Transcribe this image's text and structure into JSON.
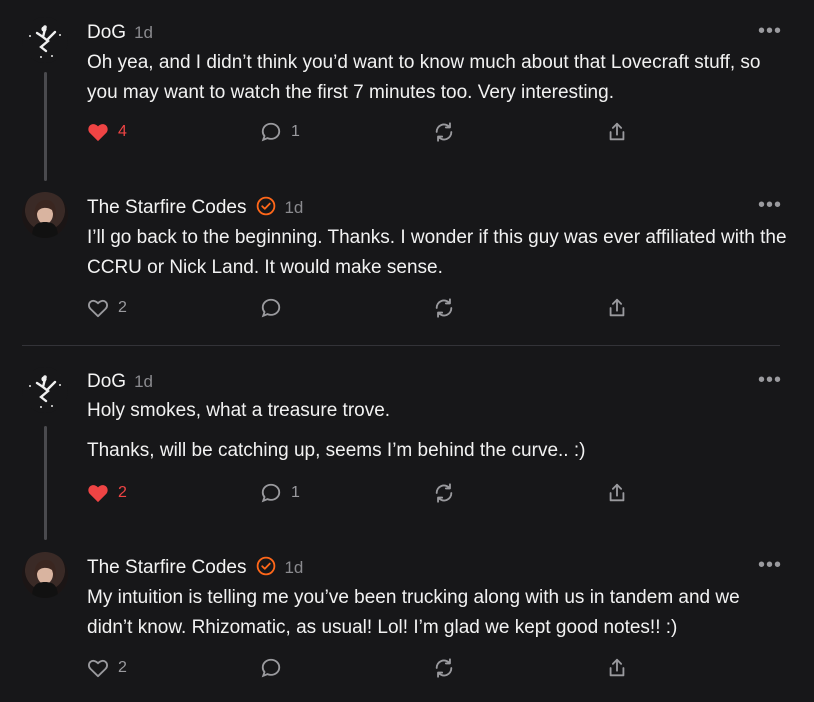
{
  "posts": [
    {
      "author": "DoG",
      "time": "1d",
      "verified": false,
      "paragraphs": [
        "Oh yea, and I didn’t think you’d want to know much about that Lovecraft stuff, so you may want to watch the first 7 minutes too. Very interesting."
      ],
      "likes": "4",
      "liked": true,
      "replies": "1"
    },
    {
      "author": "The Starfire Codes",
      "time": "1d",
      "verified": true,
      "paragraphs": [
        "I’ll go back to the beginning. Thanks. I wonder if this guy was ever affiliated with the CCRU or Nick Land. It would make sense."
      ],
      "likes": "2",
      "liked": false,
      "replies": ""
    },
    {
      "author": "DoG",
      "time": "1d",
      "verified": false,
      "paragraphs": [
        "Holy smokes, what a treasure trove.",
        "Thanks, will be catching up, seems I’m behind the curve.. :)"
      ],
      "likes": "2",
      "liked": true,
      "replies": "1"
    },
    {
      "author": "The Starfire Codes",
      "time": "1d",
      "verified": true,
      "paragraphs": [
        "My intuition is telling me you’ve been trucking along with us in tandem and we didn’t know. Rhizomatic, as usual! Lol! I’m glad we kept good notes!! :)"
      ],
      "likes": "2",
      "liked": false,
      "replies": ""
    }
  ],
  "icons": {
    "like": "heart-icon",
    "reply": "comment-bubble-icon",
    "restack": "restack-icon",
    "share": "share-icon",
    "more": "more-options-icon",
    "verified": "verified-badge-icon"
  },
  "colors": {
    "background": "#171719",
    "liked": "#ef4444",
    "verified": "#ff6719",
    "muted": "#9a9a9e"
  }
}
